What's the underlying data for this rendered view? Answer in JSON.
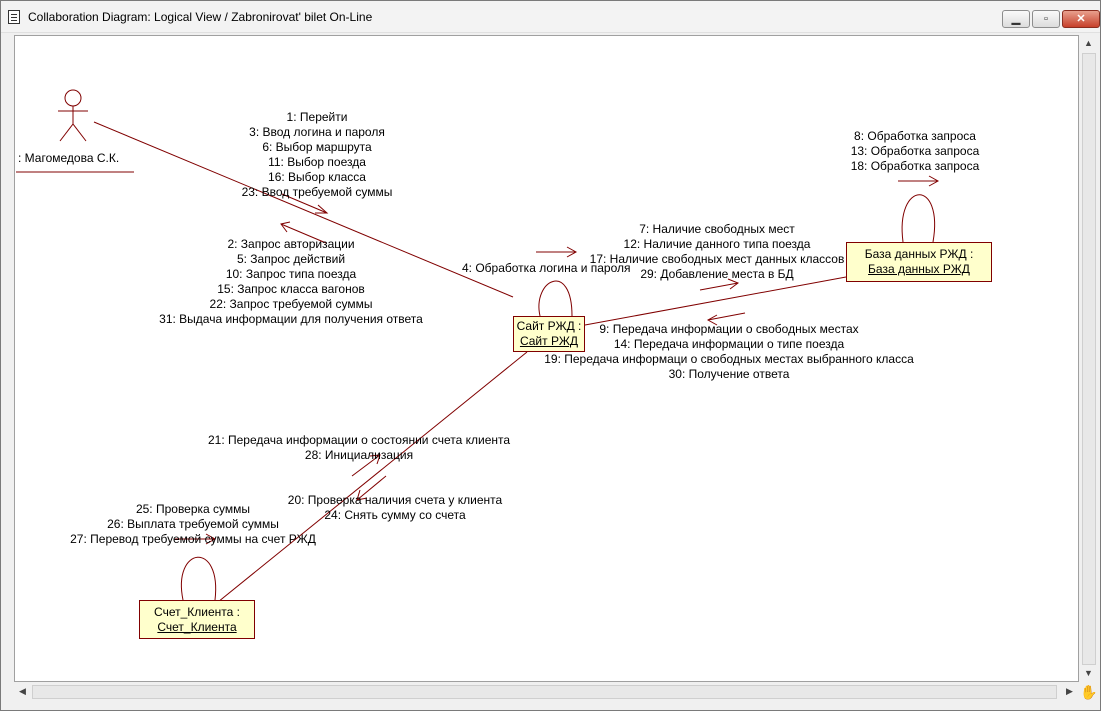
{
  "window": {
    "title": "Collaboration Diagram: Logical View / Zabronirovat' bilet On-Line"
  },
  "actor": {
    "name": ": Магомедова С.К."
  },
  "objects": {
    "site": {
      "line1": "Сайт РЖД :",
      "line2": "Сайт РЖД"
    },
    "db": {
      "line1": "База данных РЖД :",
      "line2": "База данных РЖД"
    },
    "account": {
      "line1": "Счет_Клиента :",
      "line2": "Счет_Клиента"
    }
  },
  "messages": {
    "actor_to_site": [
      "1: Перейти",
      "3: Ввод логина и пароля",
      "6: Выбор маршрута",
      "11: Выбор поезда",
      "16: Выбор класса",
      "23: Ввод требуемой суммы"
    ],
    "site_to_actor": [
      "2: Запрос авторизации",
      "5: Запрос действий",
      "10: Запрос типа поезда",
      "15: Запрос класса вагонов",
      "22: Запрос требуемой суммы",
      "31: Выдача информации для получения ответа"
    ],
    "site_self": [
      "4: Обработка логина и пароля"
    ],
    "site_to_db": [
      "7: Наличие свободных мест",
      "12: Наличие данного типа  поезда",
      "17: Наличие свободных мест данных классов",
      "29: Добавление места в БД"
    ],
    "db_self": [
      "8: Обработка запроса",
      "13: Обработка запроса",
      "18: Обработка запроса"
    ],
    "db_to_site": [
      "9: Передача информации о свободных местах",
      "14: Передача информации о типе поезда",
      "19: Передача информаци о свободных местах выбранного класса",
      "30: Получение ответа"
    ],
    "account_to_site": [
      "21: Передача информации о состоянии счета клиента",
      "28: Инициализация"
    ],
    "site_to_account": [
      "20: Проверка наличия счета у клиента",
      "24: Снять сумму со счета"
    ],
    "account_self": [
      "25: Проверка суммы",
      "26: Выплата требуемой суммы",
      "27: Перевод требуемой суммы на счет РЖД"
    ]
  },
  "colors": {
    "line": "#800000",
    "node_fill": "#ffffcc",
    "node_border": "#800000"
  }
}
